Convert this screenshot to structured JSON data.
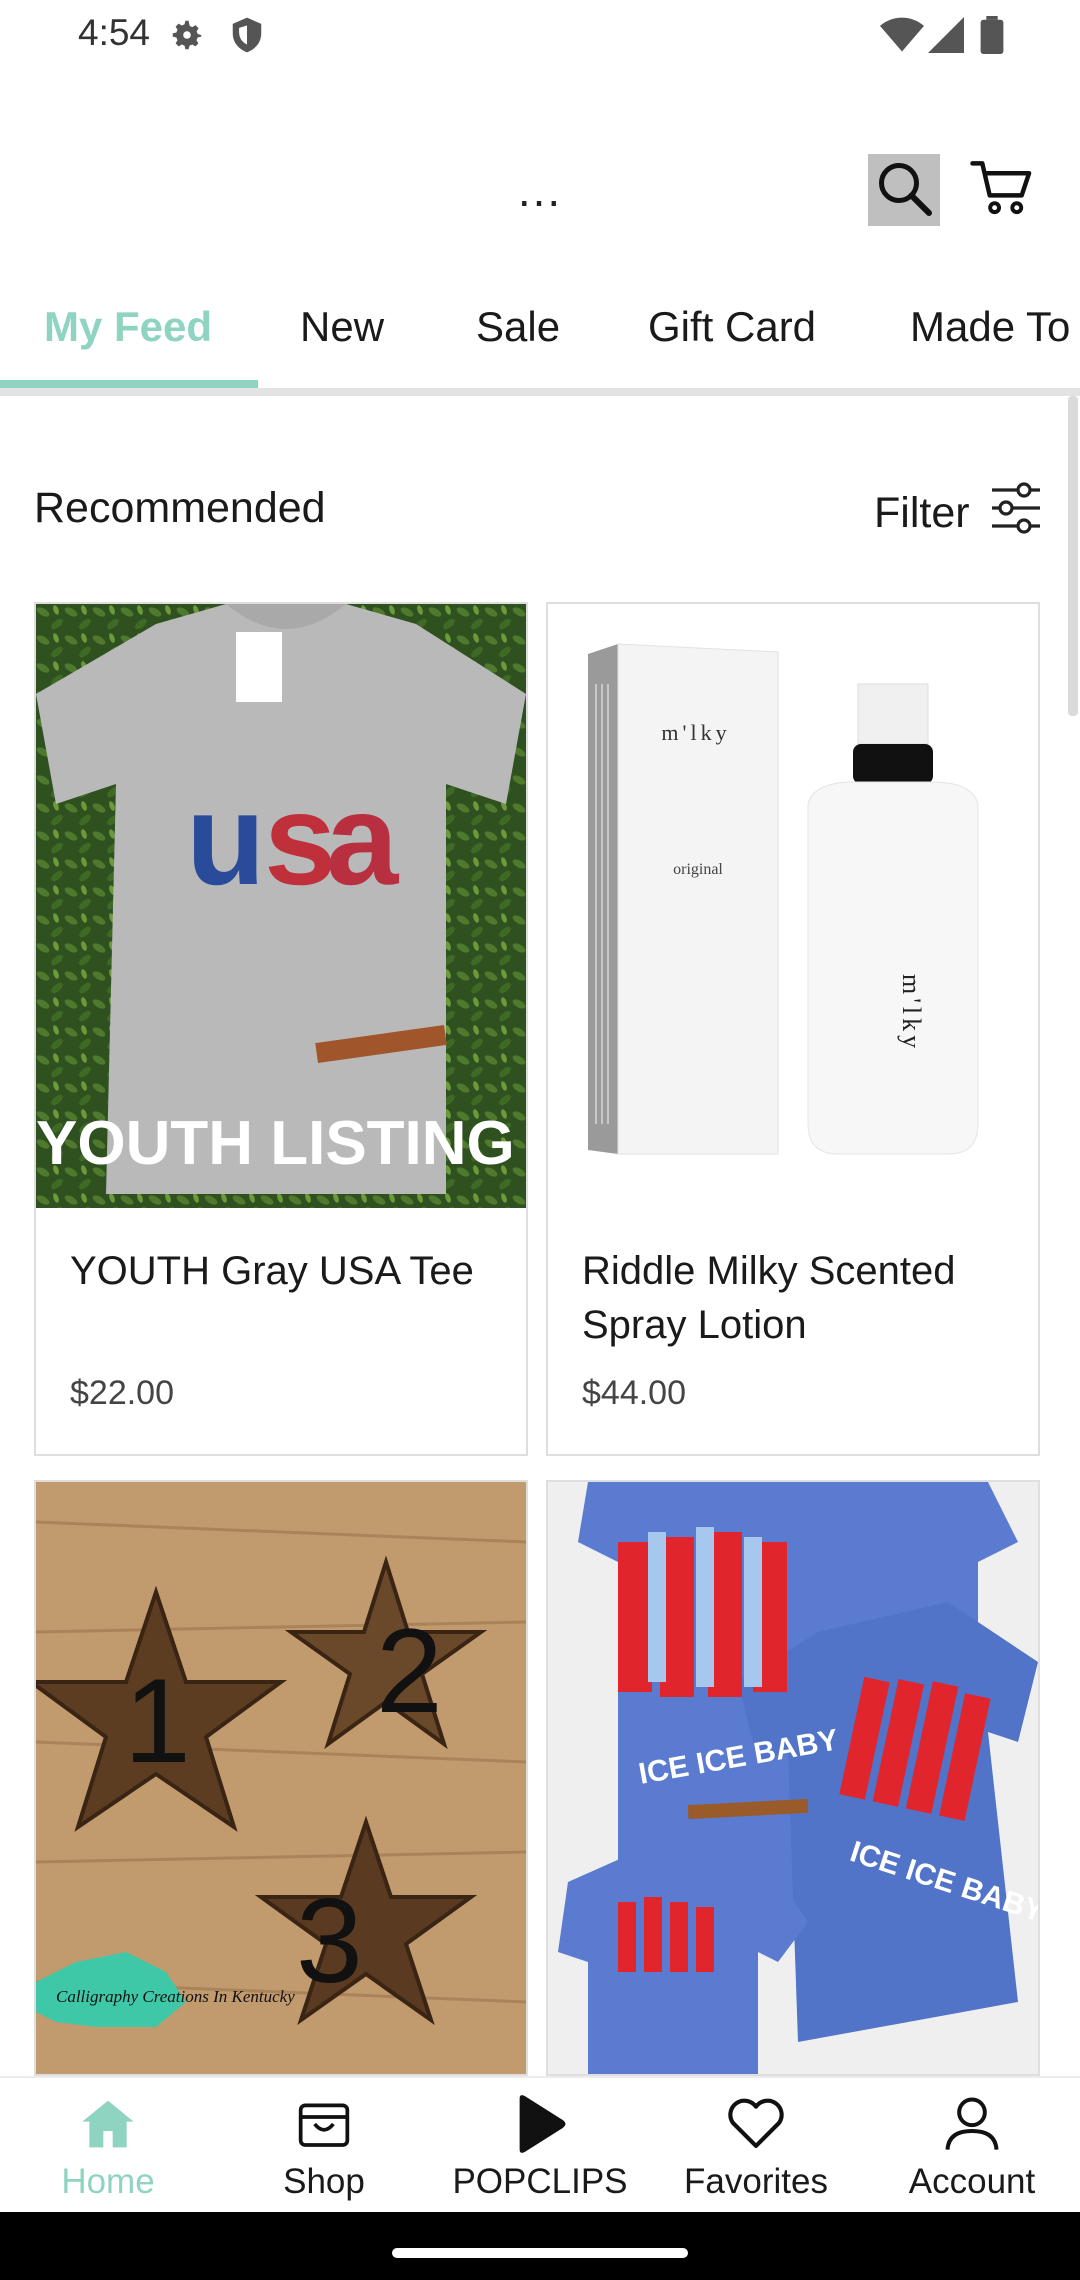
{
  "status_bar": {
    "time": "4:54"
  },
  "topbar": {
    "more_label": "...",
    "icons": [
      "settings-icon",
      "shield-icon",
      "wifi-icon",
      "signal-icon",
      "battery-icon",
      "search-icon",
      "cart-icon"
    ]
  },
  "tabs": [
    {
      "label": "My Feed",
      "active": true
    },
    {
      "label": "New"
    },
    {
      "label": "Sale"
    },
    {
      "label": "Gift Card"
    },
    {
      "label": "Made To"
    }
  ],
  "section": {
    "title": "Recommended",
    "filter_label": "Filter"
  },
  "products": [
    {
      "name": "YOUTH Gray USA Tee",
      "price": "$22.00",
      "image_text": "YOUTH LISTING"
    },
    {
      "name": "Riddle Milky Scented Spray Lotion",
      "price": "$44.00",
      "image_text": "m'lky"
    },
    {
      "name": "",
      "price": "",
      "image_text": "Calligraphy Creations In Kentucky"
    },
    {
      "name": "",
      "price": "",
      "image_text": "ICE ICE BABY"
    }
  ],
  "bottom_nav": [
    {
      "label": "Home",
      "icon": "home-icon",
      "active": true
    },
    {
      "label": "Shop",
      "icon": "shop-icon"
    },
    {
      "label": "POPCLIPS",
      "icon": "play-icon"
    },
    {
      "label": "Favorites",
      "icon": "heart-icon"
    },
    {
      "label": "Account",
      "icon": "account-icon"
    }
  ],
  "colors": {
    "accent": "#8fd3c1",
    "divider": "#e3e3e3"
  }
}
